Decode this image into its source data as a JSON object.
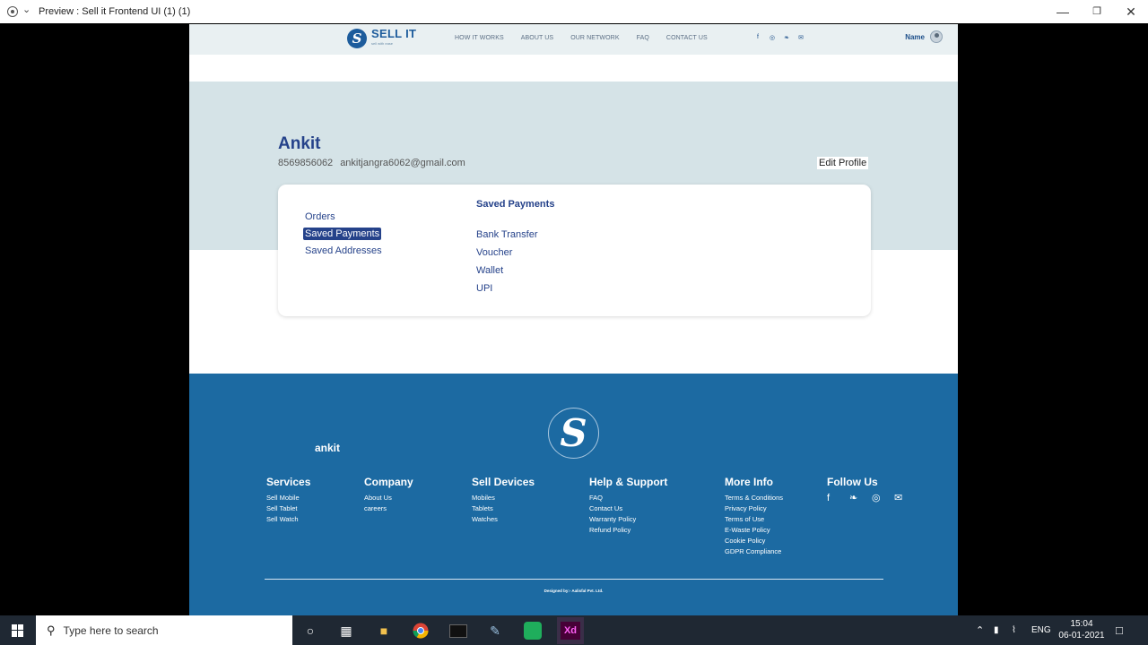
{
  "window": {
    "title": "Preview : Sell it Frontend UI (1) (1)",
    "minimize": "—",
    "maximize": "❐",
    "close": "✕"
  },
  "header": {
    "logo_text": "SELL IT",
    "logo_tagline": "sell with ease",
    "nav": [
      "HOW IT WORKS",
      "ABOUT US",
      "OUR NETWORK",
      "FAQ",
      "CONTACT US"
    ],
    "social": [
      "f",
      "◎",
      "❧",
      "✉"
    ],
    "user_name": "Name"
  },
  "profile": {
    "name": "Ankit",
    "phone": "8569856062",
    "email": "ankitjangra6062@gmail.com",
    "edit_label": "Edit Profile"
  },
  "account_menu": [
    {
      "label": "Orders",
      "active": false
    },
    {
      "label": "Saved Payments",
      "active": true
    },
    {
      "label": "Saved Addresses",
      "active": false
    }
  ],
  "saved_payments": {
    "title": "Saved Payments",
    "options": [
      "Bank Transfer",
      "Voucher",
      "Wallet",
      "UPI"
    ]
  },
  "footer": {
    "user": "ankit",
    "columns": [
      {
        "title": "Services",
        "items": [
          "Sell Mobile",
          "Sell Tablet",
          "Sell Watch"
        ]
      },
      {
        "title": "Company",
        "items": [
          "About Us",
          "careers"
        ]
      },
      {
        "title": "Sell Devices",
        "items": [
          "Mobiles",
          "Tablets",
          "Watches"
        ]
      },
      {
        "title": "Help & Support",
        "items": [
          "FAQ",
          "Contact Us",
          "Warranty Policy",
          "Refund Policy"
        ]
      },
      {
        "title": "More Info",
        "items": [
          "Terms & Conditions",
          "Privacy Policy",
          "Terms of Use",
          "E-Waste Policy",
          "Cookie Policy",
          "GDPR Compliance"
        ]
      }
    ],
    "follow_title": "Follow Us",
    "credit": "Designed by:- Aalisfal Pvt. Ltd."
  },
  "taskbar": {
    "search_placeholder": "Type here to search",
    "language": "ENG",
    "time": "15:04",
    "date": "06-01-2021"
  }
}
